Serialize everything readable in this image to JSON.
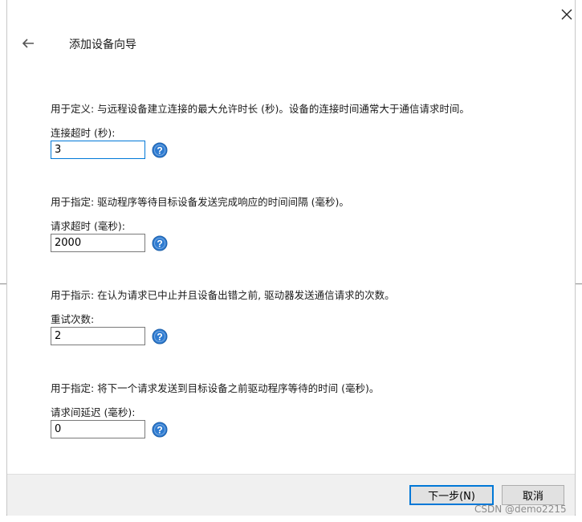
{
  "dialog": {
    "title": "添加设备向导",
    "back_icon": "arrow-left-icon",
    "close_icon": "close-icon"
  },
  "fields": [
    {
      "description": "用于定义: 与远程设备建立连接的最大允许时长 (秒)。设备的连接时间通常大于通信请求时间。",
      "label": "连接超时 (秒):",
      "value": "3",
      "help_icon": "help-icon"
    },
    {
      "description": "用于指定: 驱动程序等待目标设备发送完成响应的时间间隔 (毫秒)。",
      "label": "请求超时 (毫秒):",
      "value": "2000",
      "help_icon": "help-icon"
    },
    {
      "description": "用于指示: 在认为请求已中止并且设备出错之前, 驱动器发送通信请求的次数。",
      "label": "重试次数:",
      "value": "2",
      "help_icon": "help-icon"
    },
    {
      "description": "用于指定: 将下一个请求发送到目标设备之前驱动程序等待的时间 (毫秒)。",
      "label": "请求间延迟 (毫秒):",
      "value": "0",
      "help_icon": "help-icon"
    }
  ],
  "footer": {
    "next_label": "下一步(N)",
    "cancel_label": "取消"
  },
  "watermark": "CSDN @demo2215",
  "colors": {
    "accent": "#0078d7",
    "help_icon": "#2e7bd1",
    "footer_bg": "#f0f0f0"
  }
}
